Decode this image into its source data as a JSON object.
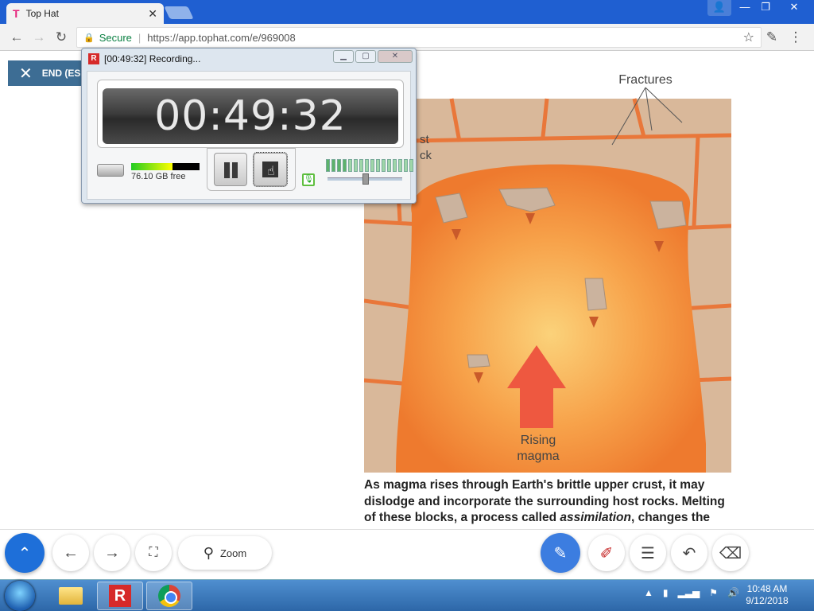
{
  "browser": {
    "tab_title": "Top Hat",
    "tab_icon": "tophat-icon",
    "address": {
      "secure_label": "Secure",
      "url": "https://app.tophat.com/e/969008"
    }
  },
  "page": {
    "end_button_label": "END (ES",
    "figure": {
      "label_fractures": "Fractures",
      "label_host_rock_fragment_1": "st",
      "label_host_rock_fragment_2": "ck",
      "label_rising_1": "Rising",
      "label_rising_2": "magma"
    },
    "caption": {
      "part1": "As magma rises through Earth's brittle upper crust, it may dislodge and incorporate the surrounding host rocks. Melting of these blocks, a process called ",
      "term": "assimilation",
      "part2": ", changes the"
    }
  },
  "recorder": {
    "title": "[00:49:32] Recording...",
    "timer": "00:49:32",
    "disk_free": "76.10 GB free",
    "disk_level": 0.6,
    "mic_level_bars_total": 16,
    "mic_level_bars_active": 4
  },
  "toolbar": {
    "zoom_label": "Zoom"
  },
  "taskbar": {
    "time": "10:48 AM",
    "date": "9/12/2018"
  },
  "colors": {
    "browser_blue": "#1f5fd1",
    "end_button": "#3d6d94",
    "primary_action": "#1e6fd9",
    "record_red": "#d62a2a"
  }
}
